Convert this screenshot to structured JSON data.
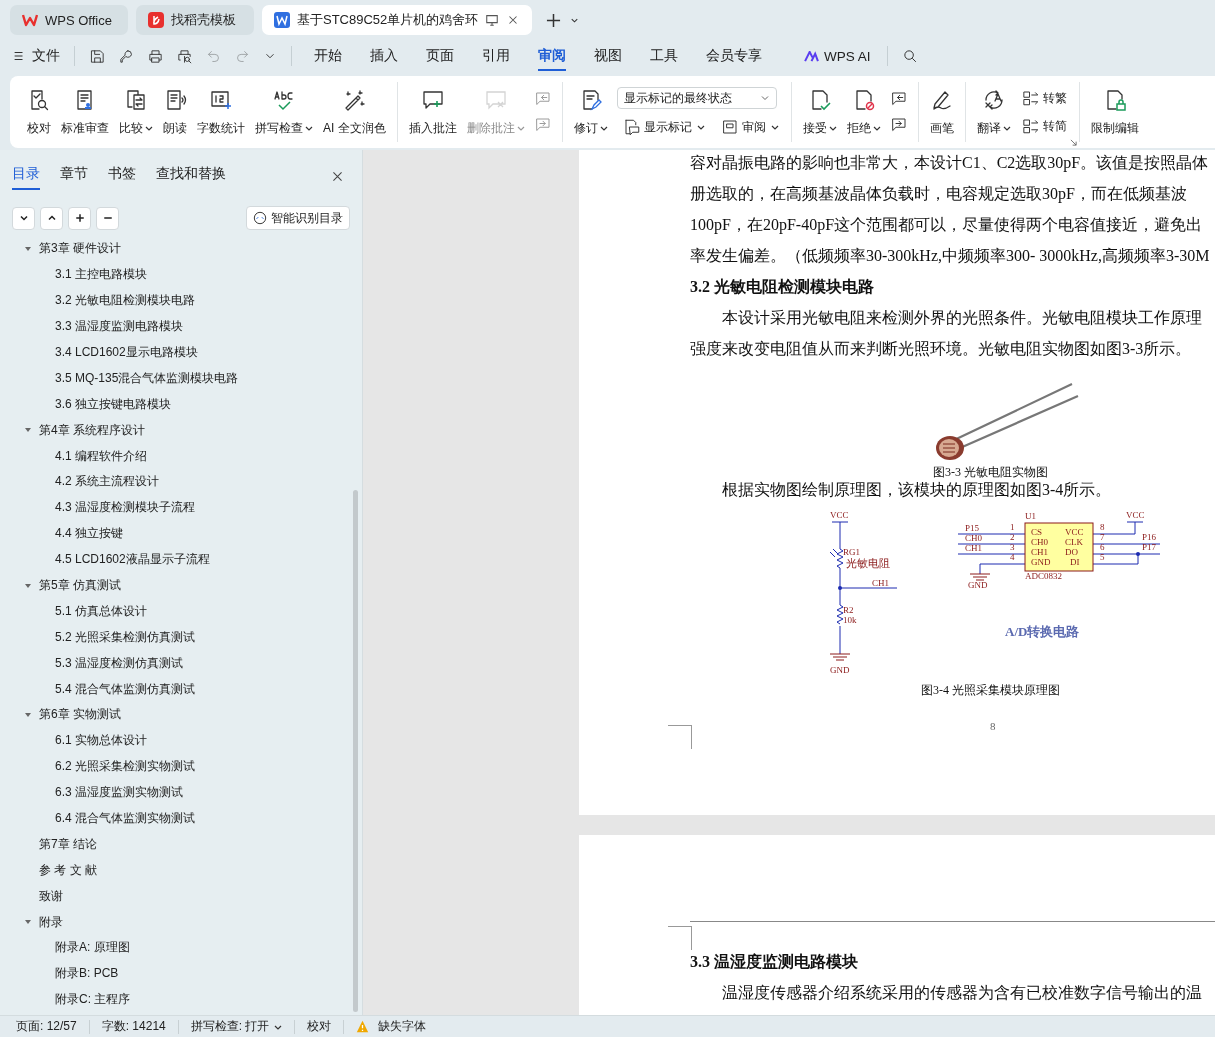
{
  "window_tabs": [
    {
      "kind": "wps",
      "label": "WPS Office",
      "selected": false
    },
    {
      "kind": "docer",
      "label": "找稻壳模板",
      "selected": false
    },
    {
      "kind": "doc",
      "label": "基于STC89C52单片机的鸡舍环",
      "selected": true
    }
  ],
  "menu": {
    "file_label": "文件",
    "quick_access": [
      {
        "disabled": false
      },
      {
        "disabled": false
      },
      {
        "disabled": false
      },
      {
        "disabled": false
      },
      {
        "disabled": true
      },
      {
        "disabled": true
      },
      {
        "disabled": false
      }
    ],
    "tabs": [
      {
        "label": "开始",
        "selected": false
      },
      {
        "label": "插入",
        "selected": false
      },
      {
        "label": "页面",
        "selected": false
      },
      {
        "label": "引用",
        "selected": false
      },
      {
        "label": "审阅",
        "selected": true
      },
      {
        "label": "视图",
        "selected": false
      },
      {
        "label": "工具",
        "selected": false
      },
      {
        "label": "会员专享",
        "selected": false
      }
    ],
    "ai_label": "WPS AI"
  },
  "ribbon": {
    "groups": [
      {
        "items": [
          {
            "kind": "large",
            "label": "校对",
            "menu": false,
            "disabled": false
          },
          {
            "kind": "large",
            "label": "标准审查",
            "menu": false,
            "disabled": false
          },
          {
            "kind": "large",
            "label": "比较",
            "menu": true,
            "disabled": false
          },
          {
            "kind": "large",
            "label": "朗读",
            "menu": false,
            "disabled": false
          },
          {
            "kind": "large",
            "label": "字数统计",
            "menu": false,
            "disabled": false
          },
          {
            "kind": "large",
            "label": "拼写检查",
            "menu": true,
            "disabled": false
          },
          {
            "kind": "large",
            "label": "AI 全文润色",
            "menu": false,
            "disabled": false
          }
        ]
      },
      {
        "items": [
          {
            "kind": "large",
            "label": "插入批注",
            "menu": false,
            "disabled": false
          },
          {
            "kind": "large",
            "label": "删除批注",
            "menu": true,
            "disabled": true
          },
          {
            "kind": "stack",
            "items": [
              {
                "kind": "small",
                "disabled": true
              },
              {
                "kind": "small",
                "disabled": true
              }
            ]
          }
        ]
      },
      {
        "items": [
          {
            "kind": "large",
            "label": "修订",
            "menu": true,
            "disabled": false
          },
          {
            "kind": "stack",
            "items": [
              {
                "kind": "select",
                "value": "显示标记的最终状态"
              },
              {
                "kind": "row",
                "items": [
                  {
                    "kind": "inline",
                    "label": "显示标记",
                    "menu": true,
                    "disabled": false
                  },
                  {
                    "kind": "inline",
                    "label": "审阅",
                    "menu": true,
                    "disabled": false
                  }
                ]
              }
            ]
          }
        ]
      },
      {
        "items": [
          {
            "kind": "large",
            "label": "接受",
            "menu": true,
            "disabled": false
          },
          {
            "kind": "large",
            "label": "拒绝",
            "menu": true,
            "disabled": false
          },
          {
            "kind": "stack",
            "items": [
              {
                "kind": "small",
                "disabled": false
              },
              {
                "kind": "small",
                "disabled": false
              }
            ]
          }
        ]
      },
      {
        "items": [
          {
            "kind": "large",
            "label": "画笔",
            "menu": false,
            "disabled": false
          }
        ]
      },
      {
        "items": [
          {
            "kind": "large",
            "label": "翻译",
            "menu": true,
            "disabled": false
          },
          {
            "kind": "stack",
            "items": [
              {
                "kind": "inline",
                "label": "转繁",
                "menu": false,
                "disabled": false
              },
              {
                "kind": "inline",
                "label": "转简",
                "menu": false,
                "disabled": false
              }
            ]
          }
        ]
      },
      {
        "items": [
          {
            "kind": "large",
            "label": "限制编辑",
            "menu": false,
            "disabled": false
          }
        ]
      }
    ]
  },
  "sidebar": {
    "tabs": [
      {
        "label": "目录",
        "selected": true
      },
      {
        "label": "章节",
        "selected": false
      },
      {
        "label": "书签",
        "selected": false
      },
      {
        "label": "查找和替换",
        "selected": false
      }
    ],
    "smart_button": "智能识别目录",
    "outline": [
      {
        "label": "第3章  硬件设计",
        "expanded": true,
        "children": [
          {
            "label": "3.1  主控电路模块"
          },
          {
            "label": "3.2  光敏电阻检测模块电路"
          },
          {
            "label": "3.3  温湿度监测电路模块"
          },
          {
            "label": "3.4 LCD1602显示电路模块"
          },
          {
            "label": "3.5 MQ-135混合气体监测模块电路"
          },
          {
            "label": "3.6  独立按键电路模块"
          }
        ]
      },
      {
        "label": "第4章  系统程序设计",
        "expanded": true,
        "children": [
          {
            "label": "4.1  编程软件介绍"
          },
          {
            "label": "4.2  系统主流程设计"
          },
          {
            "label": "4.3  温湿度检测模块子流程"
          },
          {
            "label": "4.4  独立按键"
          },
          {
            "label": "4.5 LCD1602液晶显示子流程"
          }
        ]
      },
      {
        "label": "第5章  仿真测试",
        "expanded": true,
        "children": [
          {
            "label": "5.1  仿真总体设计"
          },
          {
            "label": "5.2  光照采集检测仿真测试"
          },
          {
            "label": "5.3  温湿度检测仿真测试"
          },
          {
            "label": "5.4  混合气体监测仿真测试"
          }
        ]
      },
      {
        "label": "第6章  实物测试",
        "expanded": true,
        "children": [
          {
            "label": "6.1  实物总体设计"
          },
          {
            "label": "6.2  光照采集检测实物测试"
          },
          {
            "label": "6.3  温湿度监测实物测试"
          },
          {
            "label": "6.4  混合气体监测实物测试"
          }
        ]
      },
      {
        "label": "第7章  结论"
      },
      {
        "label": "参 考 文 献"
      },
      {
        "label": "致谢"
      },
      {
        "label": "附录",
        "expanded": true,
        "children": [
          {
            "label": "附录A:  原理图"
          },
          {
            "label": "附录B:  PCB"
          },
          {
            "label": "附录C:  主程序"
          }
        ]
      }
    ]
  },
  "page1": {
    "lines": [
      "容对晶振电路的影响也非常大，本设计C1、C2选取30pF。该值是按照晶体",
      "册选取的，在高频基波晶体负载时，电容规定选取30pF，而在低频基波",
      "100pF，在20pF-40pF这个范围都可以，尽量使得两个电容值接近，避免出",
      "率发生偏差。（低频频率30-300kHz,中频频率300- 3000kHz,高频频率3-30M"
    ],
    "heading": "3.2  光敏电阻检测模块电路",
    "paragraph": [
      "本设计采用光敏电阻来检测外界的光照条件。光敏电阻模块工作原理",
      "强度来改变电阻值从而来判断光照环境。光敏电阻实物图如图3-3所示。"
    ],
    "figure1_caption": "图3-3  光敏电阻实物图",
    "intro": "根据实物图绘制原理图，该模块的原理图如图3-4所示。",
    "schematic": {
      "labels": [
        "VCC",
        "RG1",
        "光敏电阻",
        "CH1",
        "R2",
        "10k",
        "GND",
        "U1",
        "P15",
        "CH0",
        "CH1",
        "1",
        "2",
        "3",
        "4",
        "CS",
        "CH0",
        "CH1",
        "GND",
        "VCC",
        "CLK",
        "DO",
        "DI",
        "8",
        "7",
        "6",
        "5",
        "VCC",
        "P16",
        "P17",
        "GND",
        "ADC0832"
      ],
      "title": "A/D转换电路"
    },
    "figure2_caption": "图3-4  光照采集模块原理图",
    "page_number": "8"
  },
  "page2": {
    "heading": "3.3  温湿度监测电路模块",
    "line": "温湿度传感器介绍系统采用的传感器为含有已校准数字信号输出的温"
  },
  "status_bar": {
    "page": "页面: 12/57",
    "words": "字数: 14214",
    "spell": "拼写检查: 打开",
    "proof": "校对",
    "missing_font": "缺失字体"
  }
}
